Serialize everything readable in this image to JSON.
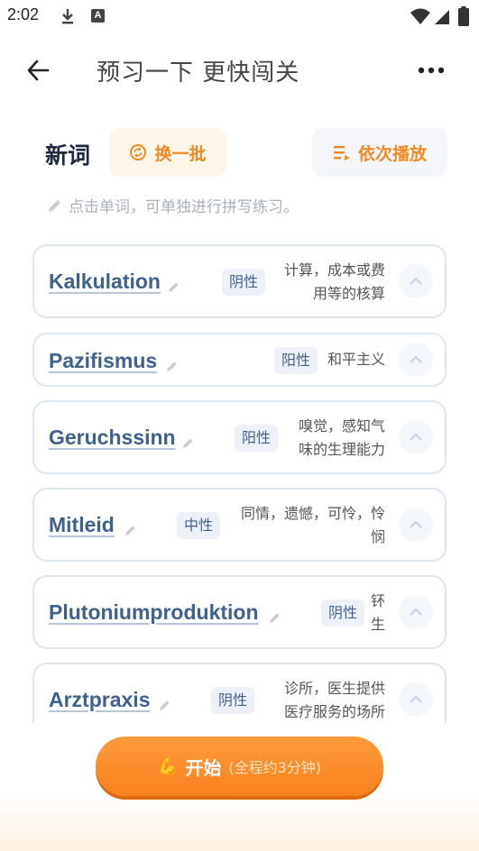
{
  "status_bar": {
    "time": "2:02"
  },
  "header": {
    "title": "预习一下 更快闯关"
  },
  "section": {
    "title": "新词",
    "swap_label": "换一批",
    "play_label": "依次播放",
    "hint": "点击单词，可单独进行拼写练习。"
  },
  "words": [
    {
      "term": "Kalkulation",
      "gender": "阴性",
      "meaning_lines": [
        "计算，成本或费",
        "用等的核算"
      ]
    },
    {
      "term": "Pazifismus",
      "gender": "阳性",
      "meaning_lines": [
        "和平主义"
      ]
    },
    {
      "term": "Geruchssinn",
      "gender": "阳性",
      "meaning_lines": [
        "嗅觉，感知气",
        "味的生理能力"
      ]
    },
    {
      "term": "Mitleid",
      "gender": "中性",
      "meaning_lines": [
        "同情，遗憾，可怜，怜",
        "悯"
      ]
    },
    {
      "term": "Plutoniumproduktion",
      "gender": "阴性",
      "meaning_lines": [
        "钚",
        "生"
      ]
    },
    {
      "term": "Arztpraxis",
      "gender": "阴性",
      "meaning_lines": [
        "诊所，医生提供",
        "医疗服务的场所"
      ]
    }
  ],
  "start_button": {
    "label": "开始",
    "sub": "(全程约3分钟)",
    "emoji": "💪"
  },
  "colors": {
    "accent": "#f08a24",
    "word": "#40618e",
    "card_border": "#dde6f3"
  }
}
